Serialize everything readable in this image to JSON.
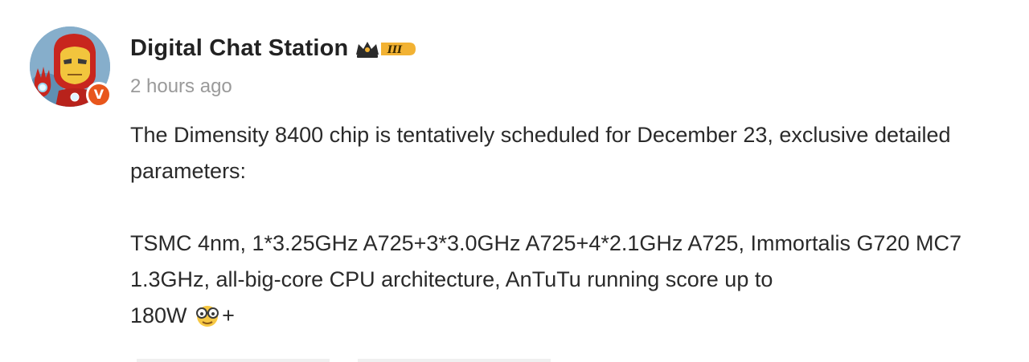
{
  "post": {
    "author": "Digital Chat Station",
    "rank_label": "III",
    "verified_mark": "V",
    "time": "2 hours ago",
    "paragraphs": [
      "The Dimensity 8400 chip is tentatively scheduled for December 23, exclusive detailed parameters:",
      "TSMC 4nm, 1*3.25GHz A725+3*3.0GHz A725+4*2.1GHz A725, Immortalis G720 MC7 1.3GHz, all-big-core CPU architecture, AnTuTu running score up to"
    ],
    "tail_text": "180W",
    "tail_suffix": "+",
    "emoji": "nerd-glasses-emoji"
  },
  "colors": {
    "author": "#222222",
    "time": "#9a9a9a",
    "body": "#2a2a2a",
    "verified": "#e8561c",
    "rank_gold": "#f2b233"
  }
}
